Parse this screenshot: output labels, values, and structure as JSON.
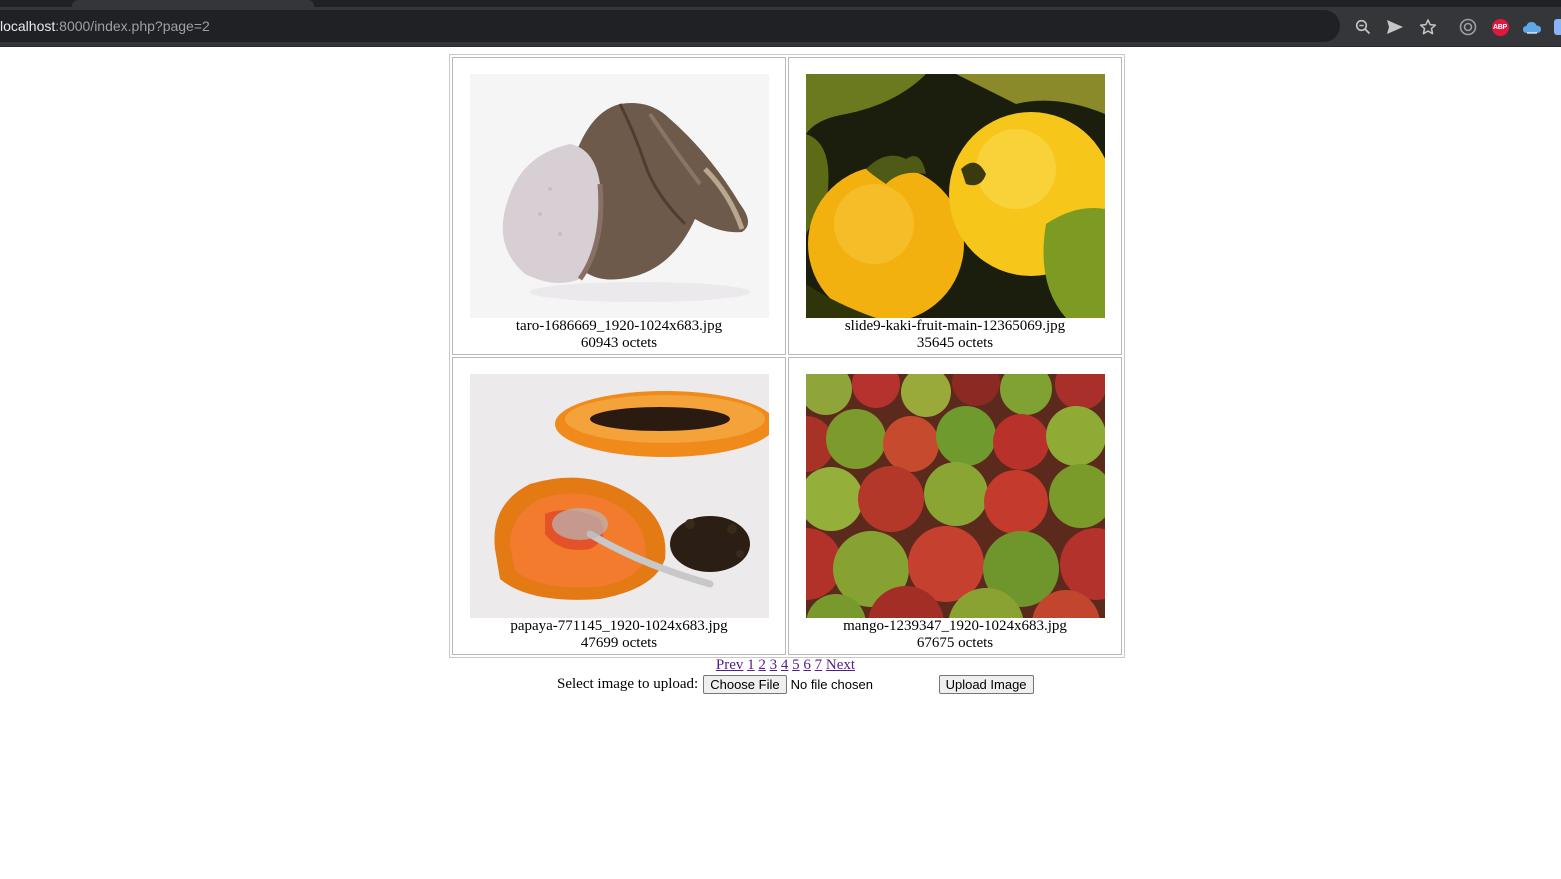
{
  "browser": {
    "url_host": "localhost",
    "url_rest": ":8000/index.php?page=2",
    "icons": [
      "zoom-icon",
      "send-tab-icon",
      "bookmark-star-icon",
      "extension-icon",
      "adblock-icon",
      "cloud-icon",
      "profile-icon"
    ],
    "abp_label": "ABP"
  },
  "gallery": {
    "images": [
      {
        "filename": "taro-1686669_1920-1024x683.jpg",
        "size": "60943 octets",
        "subject": "taro"
      },
      {
        "filename": "slide9-kaki-fruit-main-12365069.jpg",
        "size": "35645 octets",
        "subject": "kaki"
      },
      {
        "filename": "papaya-771145_1920-1024x683.jpg",
        "size": "47699 octets",
        "subject": "papaya"
      },
      {
        "filename": "mango-1239347_1920-1024x683.jpg",
        "size": "67675 octets",
        "subject": "mango"
      }
    ]
  },
  "pagination": {
    "prev": "Prev",
    "pages": [
      "1",
      "2",
      "3",
      "4",
      "5",
      "6",
      "7"
    ],
    "next": "Next"
  },
  "upload": {
    "label": "Select image to upload:",
    "choose_button": "Choose File",
    "no_file": "No file chosen",
    "submit_button": "Upload Image"
  }
}
